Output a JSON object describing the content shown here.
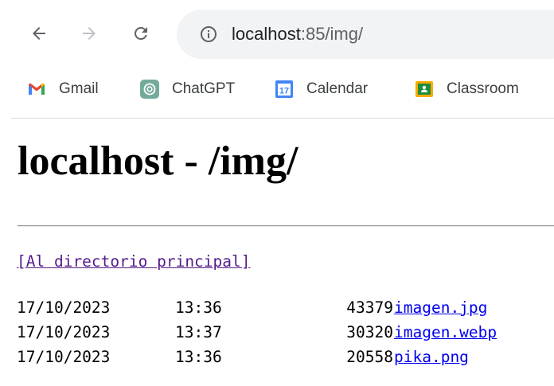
{
  "browser": {
    "address_host": "localhost",
    "address_rest": ":85/img/",
    "bookmarks": [
      {
        "label": "Gmail",
        "icon": "gmail-icon"
      },
      {
        "label": "ChatGPT",
        "icon": "chatgpt-icon"
      },
      {
        "label": "Calendar",
        "icon": "calendar-icon",
        "icon_text": "17"
      },
      {
        "label": "Classroom",
        "icon": "classroom-icon"
      }
    ]
  },
  "page": {
    "title": "localhost - /img/",
    "parent_link": "[Al directorio principal]",
    "files": [
      {
        "date": "17/10/2023",
        "time": "13:36",
        "size": "43379",
        "name": "imagen.jpg"
      },
      {
        "date": "17/10/2023",
        "time": "13:37",
        "size": "30320",
        "name": "imagen.webp"
      },
      {
        "date": "17/10/2023",
        "time": "13:36",
        "size": "20558",
        "name": "pika.png"
      }
    ]
  },
  "colors": {
    "link": "#0000ee",
    "visited_link": "#551a8b",
    "omnibox_bg": "#f1f3f4"
  }
}
